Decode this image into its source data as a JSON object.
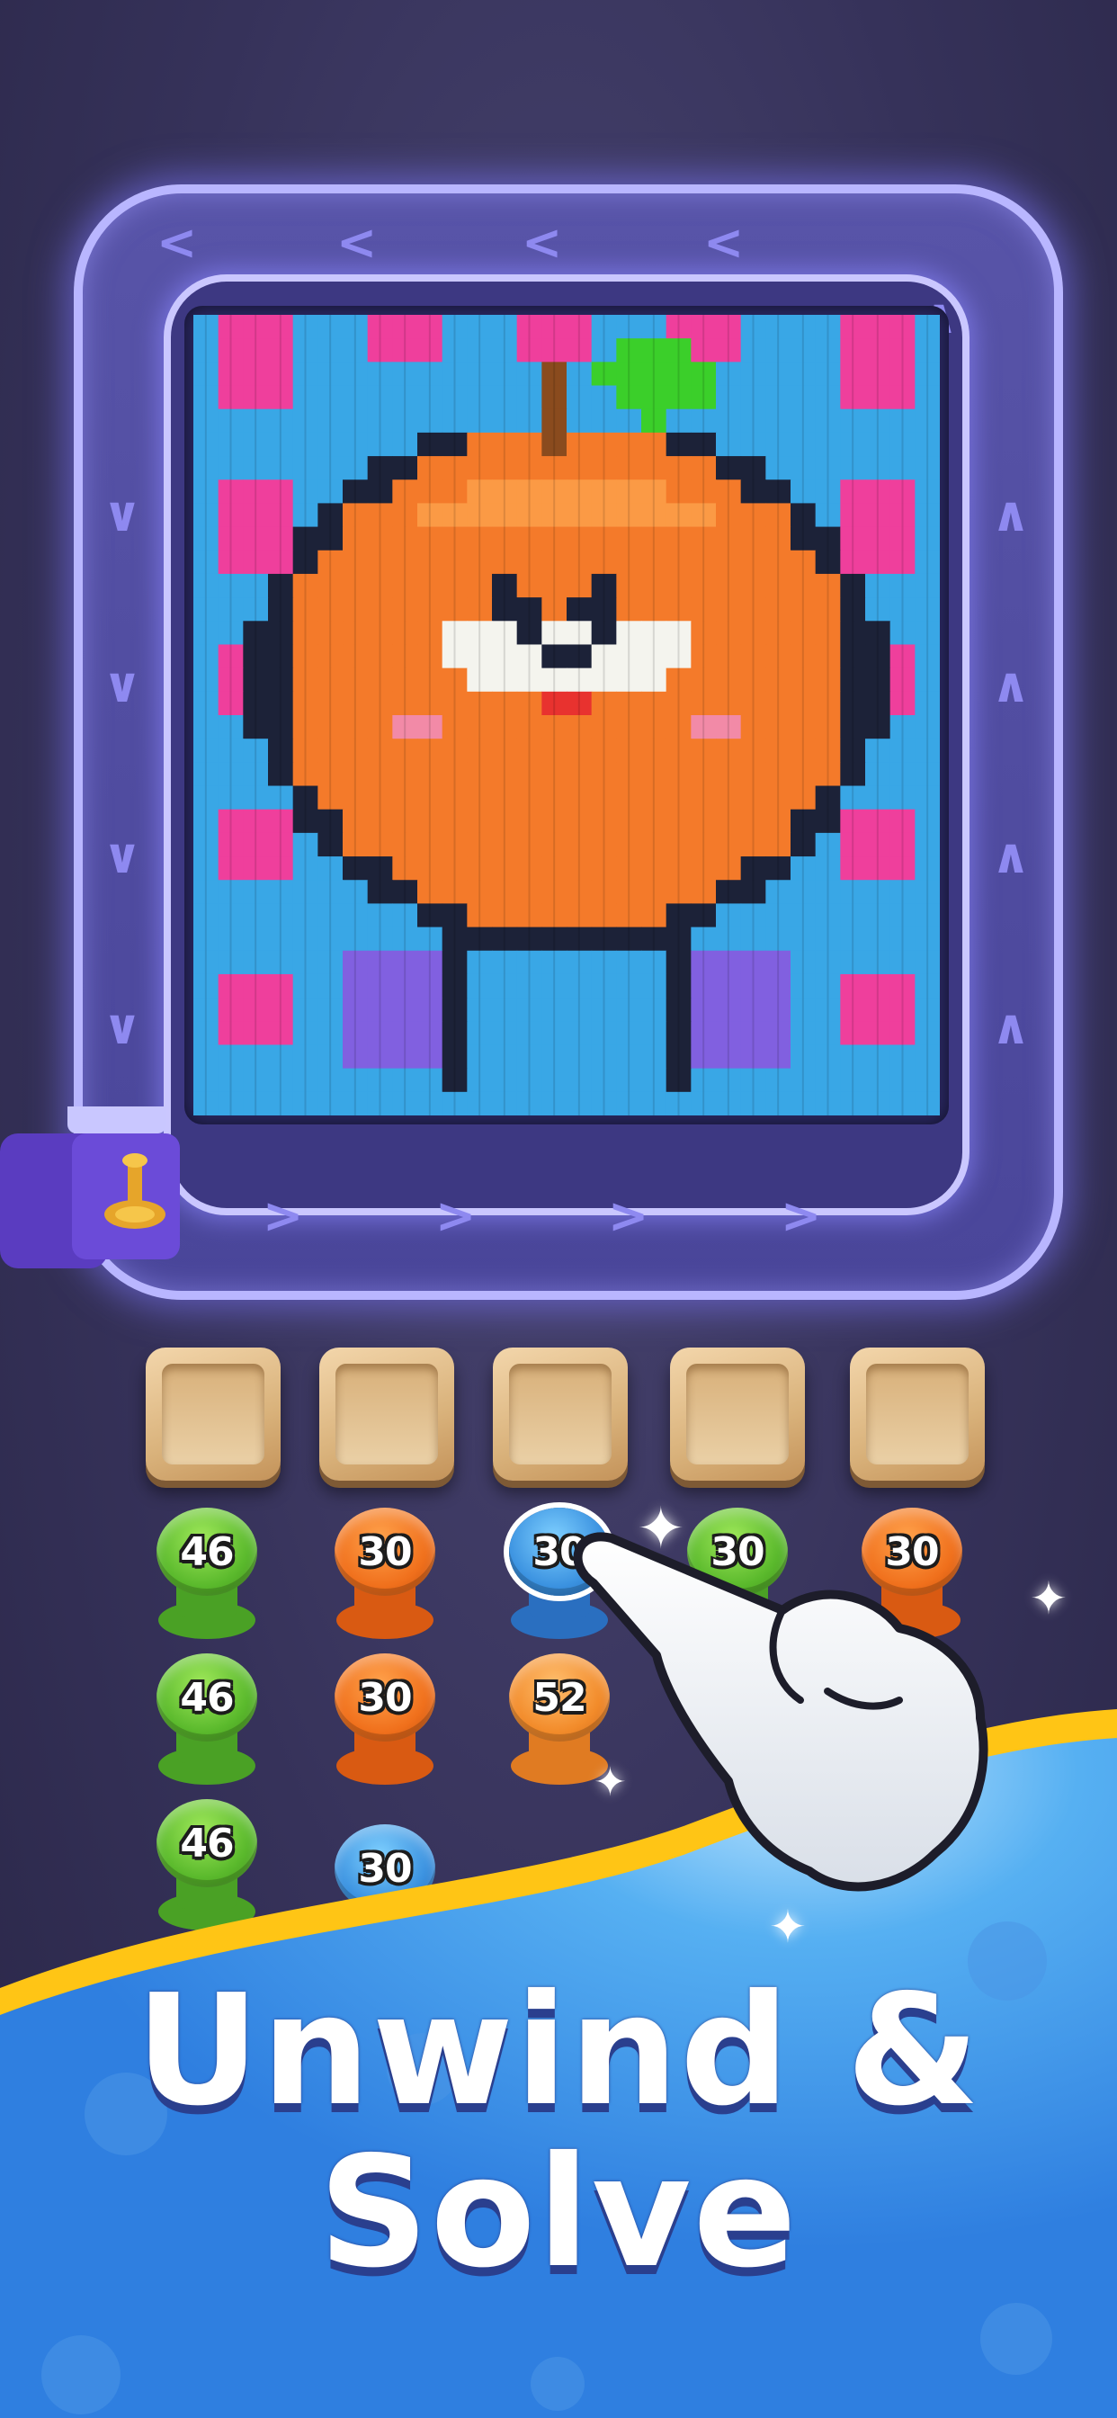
{
  "board": {
    "frame_color": "#b9b6ff",
    "conveyor_arrows": "chevron-icon",
    "knit_image": {
      "subject": "orange-character-icon",
      "palette": {
        "background": "#39a7e6",
        "stripe": "#ef3f9c",
        "outline": "#1c2238",
        "orange": "#f47a2a",
        "orange_light": "#fb9a45",
        "white": "#f4f4ee",
        "red": "#e8322f",
        "pink": "#f28aa7",
        "purple": "#8160e0",
        "green": "#3bcf2a",
        "stem": "#8a4b1e"
      }
    }
  },
  "slots": [
    {
      "state": "empty"
    },
    {
      "state": "empty"
    },
    {
      "state": "empty"
    },
    {
      "state": "empty"
    },
    {
      "state": "empty"
    }
  ],
  "spool_grid": {
    "rows": [
      [
        {
          "value": "46",
          "color": "green"
        },
        {
          "value": "30",
          "color": "orange"
        },
        {
          "value": "30",
          "color": "blue",
          "selected": true
        },
        {
          "value": "30",
          "color": "green"
        },
        {
          "value": "30",
          "color": "orange"
        }
      ],
      [
        {
          "value": "46",
          "color": "green"
        },
        {
          "value": "30",
          "color": "orange"
        },
        {
          "value": "52",
          "color": "lightorange"
        }
      ],
      [
        {
          "value": "46",
          "color": "green"
        },
        {
          "value": "30",
          "color": "blue"
        }
      ]
    ]
  },
  "headline": {
    "line1": "Unwind &",
    "line2": "Solve"
  },
  "colors": {
    "wave_blue": "#2f8de6",
    "wave_yellow": "#ffc515",
    "background": "#36325a"
  }
}
